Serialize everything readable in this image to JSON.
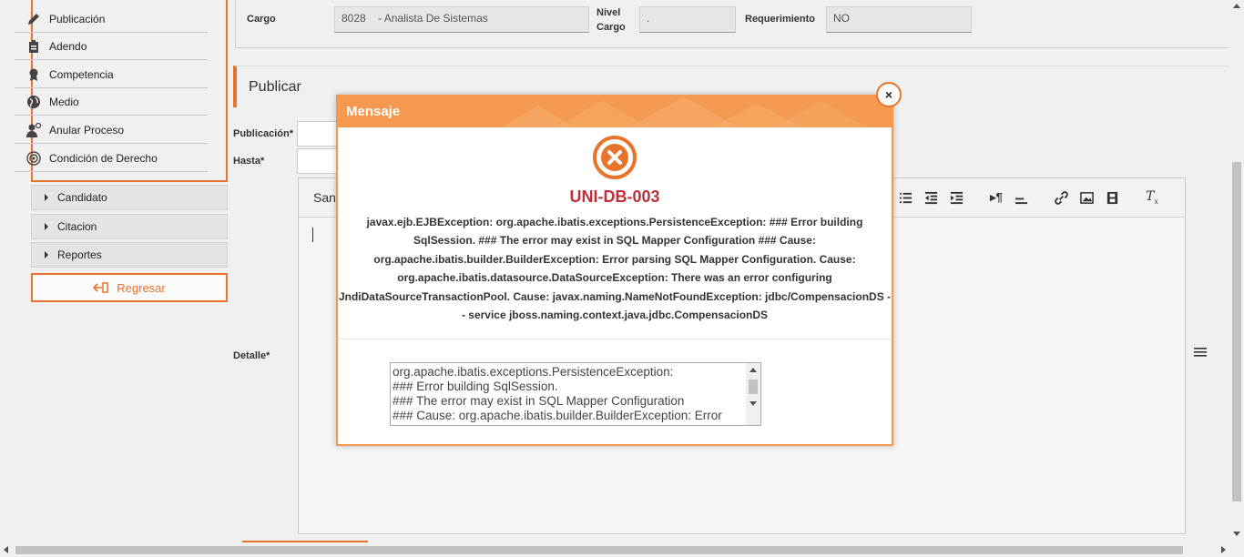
{
  "sidebar": {
    "sub_items": [
      {
        "label": "Publicación",
        "icon": "pencil-icon"
      },
      {
        "label": "Adendo",
        "icon": "clipboard-icon"
      },
      {
        "label": "Competencia",
        "icon": "award-icon"
      },
      {
        "label": "Medio",
        "icon": "globe-icon"
      },
      {
        "label": "Anular Proceso",
        "icon": "user-cancel-icon"
      },
      {
        "label": "Condición de Derecho",
        "icon": "target-icon"
      }
    ],
    "menu": [
      "Candidato",
      "Citacion",
      "Reportes"
    ],
    "back_label": "Regresar"
  },
  "form": {
    "cargo_label": "Cargo",
    "cargo_code": "8028",
    "cargo_value": "- Analista De Sistemas",
    "nivel_label": "Nivel Cargo",
    "nivel_value": ".",
    "requerimiento_label": "Requerimiento",
    "requerimiento_value": "NO"
  },
  "publicar": {
    "title": "Publicar",
    "publicacion_label": "Publicación*",
    "hasta_label": "Hasta*",
    "detalle_label": "Detalle*",
    "font_partial": "San"
  },
  "modal": {
    "title": "Mensaje",
    "close": "×",
    "error_code": "UNI-DB-003",
    "message": "javax.ejb.EJBException: org.apache.ibatis.exceptions.PersistenceException: ### Error building SqlSession. ### The error may exist in SQL Mapper Configuration ### Cause: org.apache.ibatis.builder.BuilderException: Error parsing SQL Mapper Configuration. Cause: org.apache.ibatis.datasource.DataSourceException: There was an error configuring JndiDataSourceTransactionPool. Cause: javax.naming.NameNotFoundException: jdbc/CompensacionDS -- service jboss.naming.context.java.jdbc.CompensacionDS",
    "detail": "org.apache.ibatis.exceptions.PersistenceException:\n### Error building SqlSession.\n### The error may exist in SQL Mapper Configuration\n### Cause: org.apache.ibatis.builder.BuilderException: Error"
  },
  "colors": {
    "accent": "#e8742b",
    "modal_header": "#f4994f",
    "error_red": "#c0303a"
  }
}
